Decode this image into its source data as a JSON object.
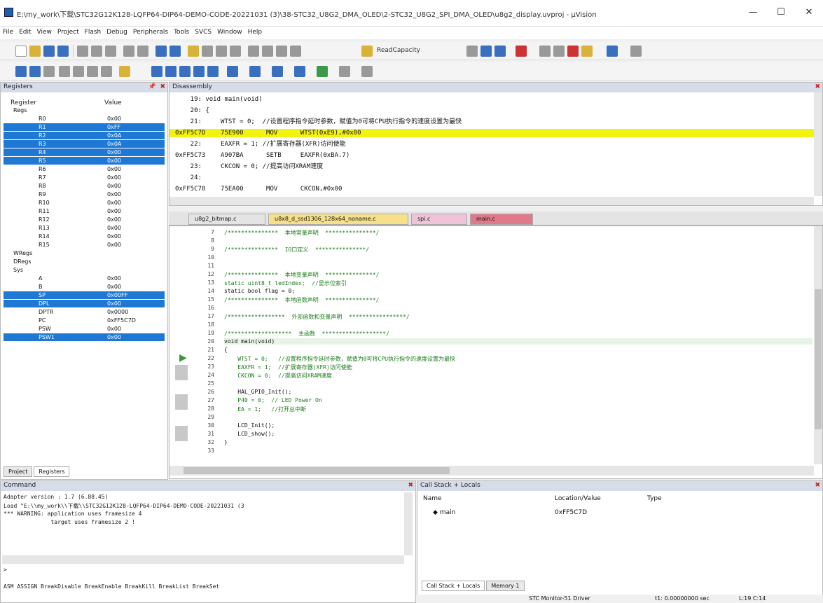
{
  "window": {
    "title": "E:\\my_work\\下载\\STC32G12K128-LQFP64-DIP64-DEMO-CODE-20221031 (3)\\38-STC32_U8G2_DMA_OLED\\2-STC32_U8G2_SPI_DMA_OLED\\u8g2_display.uvproj - µVision",
    "min": "—",
    "max": "☐",
    "close": "✕"
  },
  "menu": [
    "File",
    "Edit",
    "View",
    "Project",
    "Flash",
    "Debug",
    "Peripherals",
    "Tools",
    "SVCS",
    "Window",
    "Help"
  ],
  "toolbar": {
    "readcapacity": "ReadCapacity"
  },
  "registers": {
    "title": "Registers",
    "col_register": "Register",
    "col_value": "Value",
    "rows": [
      {
        "name": "Regs",
        "value": "",
        "grp": true,
        "sel": false
      },
      {
        "name": "R0",
        "value": "0x00",
        "sel": false
      },
      {
        "name": "R1",
        "value": "0xFF",
        "sel": true
      },
      {
        "name": "R2",
        "value": "0x0A",
        "sel": true
      },
      {
        "name": "R3",
        "value": "0x0A",
        "sel": true
      },
      {
        "name": "R4",
        "value": "0x00",
        "sel": true
      },
      {
        "name": "R5",
        "value": "0x00",
        "sel": true
      },
      {
        "name": "R6",
        "value": "0x00",
        "sel": false
      },
      {
        "name": "R7",
        "value": "0x00",
        "sel": false
      },
      {
        "name": "R8",
        "value": "0x00",
        "sel": false
      },
      {
        "name": "R9",
        "value": "0x00",
        "sel": false
      },
      {
        "name": "R10",
        "value": "0x00",
        "sel": false
      },
      {
        "name": "R11",
        "value": "0x00",
        "sel": false
      },
      {
        "name": "R12",
        "value": "0x00",
        "sel": false
      },
      {
        "name": "R13",
        "value": "0x00",
        "sel": false
      },
      {
        "name": "R14",
        "value": "0x00",
        "sel": false
      },
      {
        "name": "R15",
        "value": "0x00",
        "sel": false
      },
      {
        "name": "WRegs",
        "value": "",
        "grp": true,
        "sel": false
      },
      {
        "name": "DRegs",
        "value": "",
        "grp": true,
        "sel": false
      },
      {
        "name": "Sys",
        "value": "",
        "grp": true,
        "sel": false
      },
      {
        "name": "A",
        "value": "0x00",
        "sel": false
      },
      {
        "name": "B",
        "value": "0x00",
        "sel": false
      },
      {
        "name": "SP",
        "value": "0x00FF",
        "sel": true
      },
      {
        "name": "DPL",
        "value": "0x00",
        "sel": true
      },
      {
        "name": "DPTR",
        "value": "0x0000",
        "sel": false
      },
      {
        "name": "PC",
        "value": "0xFF5C7D",
        "sel": false
      },
      {
        "name": "PSW",
        "value": "0x00",
        "sel": false
      },
      {
        "name": "PSW1",
        "value": "0x00",
        "sel": true
      }
    ],
    "tab_project": "Project",
    "tab_registers": "Registers"
  },
  "disasm": {
    "title": "Disassembly",
    "lines": [
      {
        "text": "    19: void main(void)",
        "hl": false
      },
      {
        "text": "    20: {",
        "hl": false
      },
      {
        "text": "    21:     WTST = 0;  //设置程序指令延时参数，赋值为0可将CPU执行指令的速度设置为最快",
        "hl": false
      },
      {
        "text": "0xFF5C7D    75E900      MOV      WTST(0xE9),#0x00",
        "hl": true
      },
      {
        "text": "    22:     EAXFR = 1; //扩展寄存器(XFR)访问使能",
        "hl": false
      },
      {
        "text": "0xFF5C73    A907BA      SETB     EAXFR(0xBA.7)",
        "hl": false
      },
      {
        "text": "    23:     CKCON = 0; //提高访问XRAM速度",
        "hl": false
      },
      {
        "text": "    24:",
        "hl": false
      },
      {
        "text": "0xFF5C78    75EA00      MOV      CKCON,#0x00",
        "hl": false
      }
    ]
  },
  "tabs": [
    {
      "label": "u8g2_bitmap.c",
      "color": "#ffffff"
    },
    {
      "label": "u8x8_d_ssd1306_128x64_noname.c",
      "color": "#f7e08a"
    },
    {
      "label": "spi.c",
      "color": "#f0c4d8"
    },
    {
      "label": "main.c",
      "color": "#e07a8a"
    }
  ],
  "editor": {
    "lines": [
      {
        "n": "7",
        "t": "/***************  本地常量声明  ***************/"
      },
      {
        "n": "8",
        "t": ""
      },
      {
        "n": "9",
        "t": "/***************  IO口定义  ***************/"
      },
      {
        "n": "10",
        "t": ""
      },
      {
        "n": "11",
        "t": ""
      },
      {
        "n": "12",
        "t": "/***************  本地变量声明  ***************/"
      },
      {
        "n": "13",
        "t": "static uint8_t ledIndex;  //显示位索引"
      },
      {
        "n": "14",
        "t": "static bool flag = 0;"
      },
      {
        "n": "15",
        "t": "/***************  本地函数声明  ***************/"
      },
      {
        "n": "16",
        "t": ""
      },
      {
        "n": "17",
        "t": "/*****************  外部函数和变量声明  *****************/"
      },
      {
        "n": "18",
        "t": ""
      },
      {
        "n": "19",
        "t": "/*******************  主函数  *******************/"
      },
      {
        "n": "20",
        "t": "void main(void)"
      },
      {
        "n": "21",
        "t": "{"
      },
      {
        "n": "22",
        "t": "    WTST = 0;   //设置程序指令延时参数，赋值为0可将CPU执行指令的速度设置为最快"
      },
      {
        "n": "23",
        "t": "    EAXFR = 1;  //扩展寄存器(XFR)访问使能"
      },
      {
        "n": "24",
        "t": "    CKCON = 0;  //提高访问XRAM速度"
      },
      {
        "n": "25",
        "t": ""
      },
      {
        "n": "26",
        "t": "    HAL_GPIO_Init();"
      },
      {
        "n": "27",
        "t": "    P40 = 0;  // LED Power On"
      },
      {
        "n": "28",
        "t": "    EA = 1;   //打开总中断"
      },
      {
        "n": "29",
        "t": ""
      },
      {
        "n": "30",
        "t": "    LCD_Init();"
      },
      {
        "n": "31",
        "t": "    LCD_show();"
      },
      {
        "n": "32",
        "t": "}"
      },
      {
        "n": "33",
        "t": ""
      }
    ]
  },
  "command": {
    "title": "Command",
    "lines": [
      "Adapter version : 1.7 (6.88.45)",
      "Load \"E:\\\\my_work\\\\下载\\\\STC32G12K128-LQFP64-DIP64-DEMO-CODE-20221031 (3",
      "*** WARNING: application uses framesize 4",
      "              target uses framesize 2 !"
    ],
    "prompt": ">",
    "hint": "ASM ASSIGN BreakDisable BreakEnable BreakKill BreakList BreakSet"
  },
  "callstack": {
    "title": "Call Stack + Locals",
    "col_name": "Name",
    "col_location": "Location/Value",
    "col_type": "Type",
    "rows": [
      {
        "name": "main",
        "loc": "0xFF5C7D",
        "type": ""
      }
    ],
    "tab_callstack": "Call Stack + Locals",
    "tab_memory": "Memory 1"
  },
  "status": {
    "driver": "STC Monitor-51 Driver",
    "time": "t1: 0.00000000 sec",
    "pos": "L:19 C:14"
  }
}
